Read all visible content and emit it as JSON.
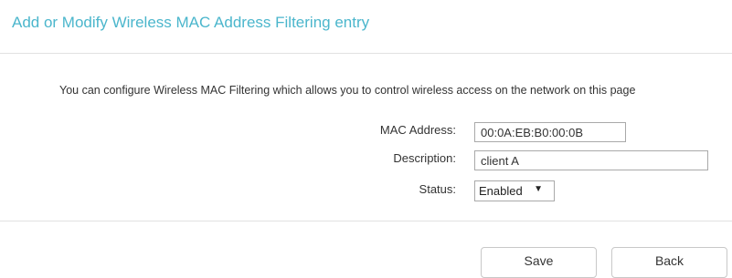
{
  "page": {
    "title": "Add or Modify Wireless MAC Address Filtering entry",
    "intro": "You can configure Wireless MAC Filtering which allows you to control wireless access on the network on this page"
  },
  "form": {
    "mac_address": {
      "label": "MAC Address:",
      "value": "00:0A:EB:B0:00:0B"
    },
    "description": {
      "label": "Description:",
      "value": "client A"
    },
    "status": {
      "label": "Status:",
      "value": "Enabled",
      "dropdown_icon": "caret-down"
    }
  },
  "actions": {
    "save_label": "Save",
    "back_label": "Back"
  },
  "colors": {
    "title": "#4bb6cc",
    "divider": "#e2e2e2",
    "field_border": "#a9a9a9",
    "button_border": "#c8c8c8"
  }
}
